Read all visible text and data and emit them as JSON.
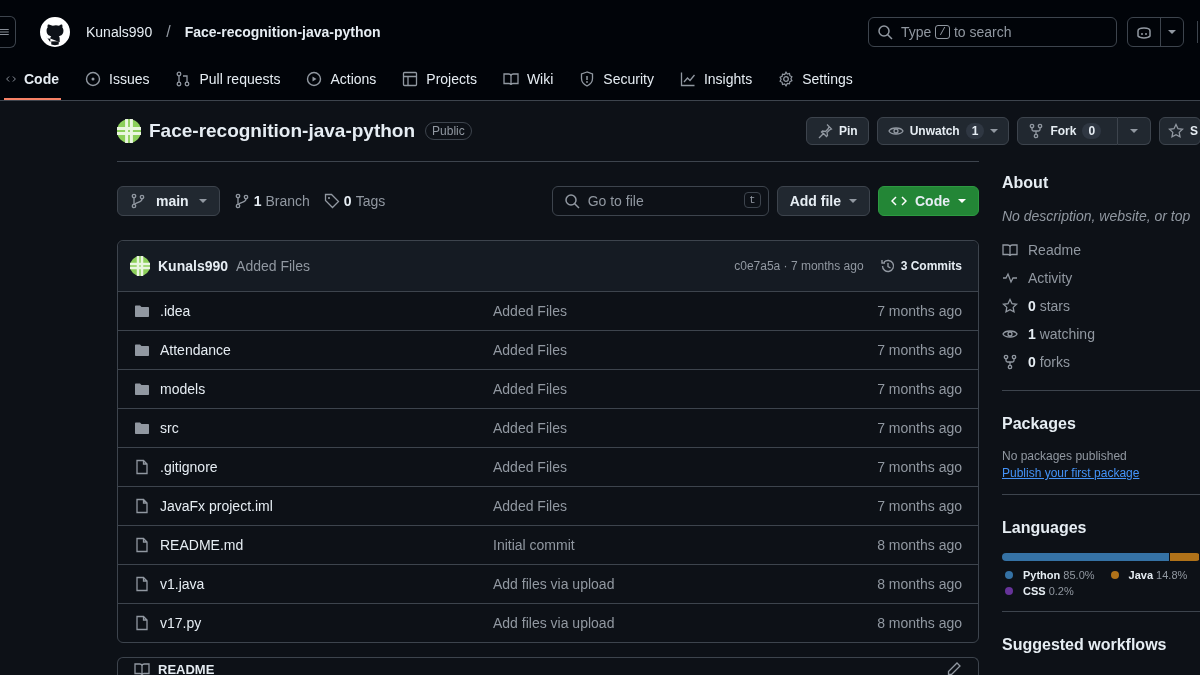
{
  "header": {
    "owner": "Kunals990",
    "separator": "/",
    "repo": "Face-recognition-java-python",
    "search": {
      "before": "Type",
      "key": "/",
      "after": "to search"
    }
  },
  "tabs": [
    {
      "label": "Code",
      "selected": true
    },
    {
      "label": "Issues",
      "selected": false
    },
    {
      "label": "Pull requests",
      "selected": false
    },
    {
      "label": "Actions",
      "selected": false
    },
    {
      "label": "Projects",
      "selected": false
    },
    {
      "label": "Wiki",
      "selected": false
    },
    {
      "label": "Security",
      "selected": false
    },
    {
      "label": "Insights",
      "selected": false
    },
    {
      "label": "Settings",
      "selected": false
    }
  ],
  "repo_header": {
    "name": "Face-recognition-java-python",
    "visibility": "Public",
    "pin": "Pin",
    "watch": {
      "label": "Unwatch",
      "count": "1"
    },
    "fork": {
      "label": "Fork",
      "count": "0"
    },
    "star": "S"
  },
  "toolbar": {
    "branch": "main",
    "branches": {
      "count": "1",
      "label": "Branch"
    },
    "tags": {
      "count": "0",
      "label": "Tags"
    },
    "search": {
      "placeholder": "Go to file",
      "key": "t"
    },
    "add_file": "Add file",
    "code": "Code"
  },
  "latest_commit": {
    "author": "Kunals990",
    "message": "Added Files",
    "hash_time": "c0e7a5a · 7 months ago",
    "commits": "3 Commits"
  },
  "files": [
    {
      "name": ".idea",
      "kind": "folder",
      "message": "Added Files",
      "time": "7 months ago"
    },
    {
      "name": "Attendance",
      "kind": "folder",
      "message": "Added Files",
      "time": "7 months ago"
    },
    {
      "name": "models",
      "kind": "folder",
      "message": "Added Files",
      "time": "7 months ago"
    },
    {
      "name": "src",
      "kind": "folder",
      "message": "Added Files",
      "time": "7 months ago"
    },
    {
      "name": ".gitignore",
      "kind": "file",
      "message": "Added Files",
      "time": "7 months ago"
    },
    {
      "name": "JavaFx project.iml",
      "kind": "file",
      "message": "Added Files",
      "time": "7 months ago"
    },
    {
      "name": "README.md",
      "kind": "file",
      "message": "Initial commit",
      "time": "8 months ago"
    },
    {
      "name": "v1.java",
      "kind": "file",
      "message": "Add files via upload",
      "time": "8 months ago"
    },
    {
      "name": "v17.py",
      "kind": "file",
      "message": "Add files via upload",
      "time": "8 months ago"
    }
  ],
  "readme": {
    "title": "README"
  },
  "about": {
    "title": "About",
    "description": "No description, website, or top",
    "items": [
      {
        "label": "Readme"
      },
      {
        "label": "Activity"
      },
      {
        "count": "0",
        "label": "stars"
      },
      {
        "count": "1",
        "label": "watching"
      },
      {
        "count": "0",
        "label": "forks"
      }
    ]
  },
  "packages": {
    "title": "Packages",
    "note": "No packages published",
    "link": "Publish your first package"
  },
  "languages": {
    "title": "Languages",
    "items": [
      {
        "name": "Python",
        "percent": "85.0%",
        "color": "#3572a5",
        "level": 0.85
      },
      {
        "name": "Java",
        "percent": "14.8%",
        "color": "#b07219",
        "level": 0.148
      },
      {
        "name": "CSS",
        "percent": "0.2%",
        "color": "#663399",
        "level": 0.002
      }
    ]
  },
  "suggested": {
    "title": "Suggested workflows"
  }
}
